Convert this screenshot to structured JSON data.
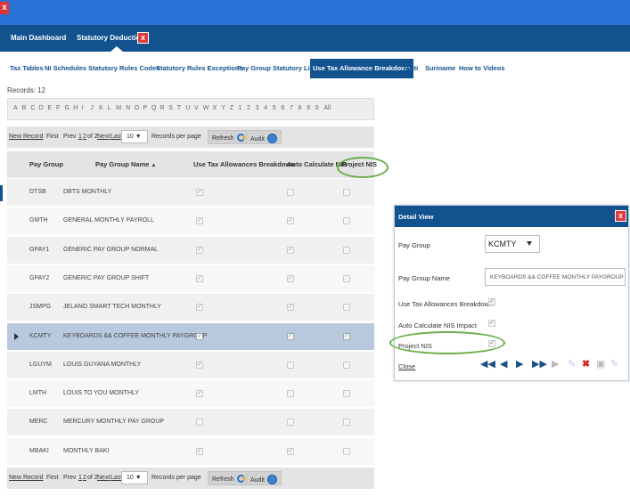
{
  "window": {
    "close_glyph": "x"
  },
  "nav": {
    "main_dashboard": "Main Dashboard",
    "statutory_deductions": "Statutory Deductions",
    "close_glyph": "x"
  },
  "tabs": [
    "Tax Tables",
    "NI Schedules",
    "Statutory Rules Codes",
    "Statutory Rules Exceptions",
    "Pay Group Statutory Link",
    "Use Tax Allowance Breakdown",
    "Haiti",
    "Suriname",
    "How to Videos"
  ],
  "records_label": "Records: 12",
  "alphabet": [
    "A",
    "B",
    "C",
    "D",
    "E",
    "F",
    "G",
    "H",
    "I",
    "J",
    "K",
    "L",
    "M",
    "N",
    "O",
    "P",
    "Q",
    "R",
    "S",
    "T",
    "U",
    "V",
    "W",
    "X",
    "Y",
    "Z",
    "1",
    "2",
    "3",
    "4",
    "5",
    "6",
    "7",
    "8",
    "9",
    "0",
    "All"
  ],
  "pager": {
    "new_record": "New Record",
    "first": "First",
    "prev": "Prev",
    "page1": "1",
    "page2": "2",
    "of_2": "of 2",
    "next": "Next",
    "last": "Last",
    "per_page_value": "10",
    "per_page_label": "Records per page",
    "refresh": "Refresh",
    "audit": "Audit"
  },
  "grid": {
    "headers": {
      "pay_group": "Pay Group",
      "pay_group_name": "Pay Group Name",
      "sort_arrow": "▲",
      "use_tax": "Use Tax Allowances Breakdown",
      "auto_calc": "Auto Calculate NIS",
      "project_nis": "Project NIS"
    },
    "rows": [
      {
        "code": "DTSB",
        "name": "DBTS MONTHLY",
        "use_tax": true,
        "auto_calc": false,
        "project_nis": false
      },
      {
        "code": "GMTH",
        "name": "GENERAL MONTHLY PAYROLL",
        "use_tax": true,
        "auto_calc": true,
        "project_nis": false
      },
      {
        "code": "GPAY1",
        "name": "GENERIC PAY GROUP NORMAL",
        "use_tax": true,
        "auto_calc": true,
        "project_nis": false
      },
      {
        "code": "GPAY2",
        "name": "GENERIC PAY GROUP SHIFT",
        "use_tax": true,
        "auto_calc": true,
        "project_nis": false
      },
      {
        "code": "JSMPG",
        "name": "JELANO SMART TECH MONTHLY",
        "use_tax": true,
        "auto_calc": true,
        "project_nis": false
      },
      {
        "code": "KCMTY",
        "name": "KEYBOARDS && COFFEE MONTHLY PAYGROUP",
        "use_tax": true,
        "auto_calc": true,
        "project_nis": true
      },
      {
        "code": "LGUYM",
        "name": "LOUIS GUYANA MONTHLY",
        "use_tax": true,
        "auto_calc": false,
        "project_nis": false
      },
      {
        "code": "LMTH",
        "name": "LOUIS TO YOU MONTHLY",
        "use_tax": true,
        "auto_calc": false,
        "project_nis": false
      },
      {
        "code": "MERC",
        "name": "MERCURY MONTHLY PAY GROUP",
        "use_tax": false,
        "auto_calc": false,
        "project_nis": false
      },
      {
        "code": "MBAKI",
        "name": "MONTHLY BAKI",
        "use_tax": true,
        "auto_calc": true,
        "project_nis": false
      }
    ],
    "selected_index": 5
  },
  "detail": {
    "title": "Detail View",
    "close_glyph": "x",
    "pay_group_label": "Pay Group",
    "pay_group_value": "KCMTY",
    "pay_group_name_label": "Pay Group Name",
    "pay_group_name_value": "KEYBOARDS && COFFEE MONTHLY PAYGROUP",
    "use_tax_label": "Use Tax Allowances Breakdown",
    "use_tax_value": true,
    "auto_calc_label": "Auto Calculate NIS Impact",
    "auto_calc_value": true,
    "project_nis_label": "Project NIS",
    "project_nis_value": true,
    "close_link": "Close",
    "toolbar_icons": [
      "first-icon",
      "prev-icon",
      "next-icon",
      "last-icon",
      "new-icon",
      "edit-icon",
      "delete-icon",
      "save-icon",
      "save-edit-icon"
    ]
  },
  "colors": {
    "topbar": "#2a73d6",
    "navbar": "#12528f",
    "highlight": "#6bae4a",
    "selected_row": "#b9c9dd",
    "close_red": "#e03a3a"
  }
}
